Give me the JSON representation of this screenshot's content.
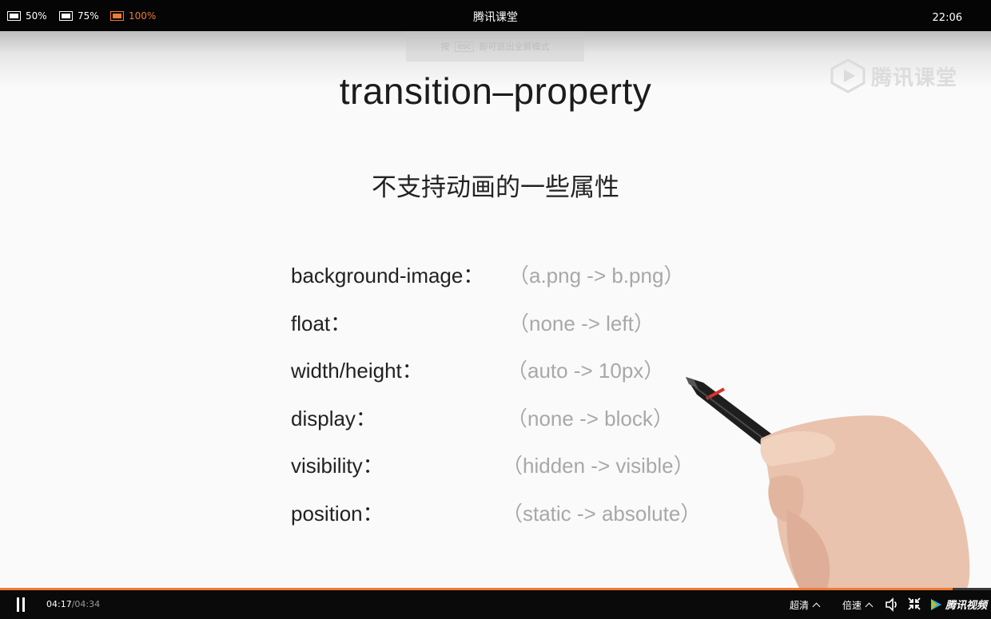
{
  "topbar": {
    "zoom_options": [
      {
        "label": "50%",
        "active": false
      },
      {
        "label": "75%",
        "active": false
      },
      {
        "label": "100%",
        "active": true
      }
    ],
    "title": "腾讯课堂",
    "clock": "22:06"
  },
  "video": {
    "esc_hint": {
      "prefix": "按",
      "key": "esc",
      "suffix": "即可退出全屏模式"
    },
    "watermark": "腾讯课堂",
    "slide": {
      "title": "transition–property",
      "subtitle": "不支持动画的一些属性",
      "rows": [
        {
          "name": "background-image：",
          "value": "（a.png -> b.png）"
        },
        {
          "name": "float：",
          "value": "（none -> left）"
        },
        {
          "name": "width/height：",
          "value": "（auto -> 10px）"
        },
        {
          "name": "display：",
          "value": "（none -> block）"
        },
        {
          "name": "visibility：",
          "value": "（hidden ->  visible）"
        },
        {
          "name": "position：",
          "value": "（static -> absolute）"
        }
      ]
    }
  },
  "player": {
    "progress": 0.961,
    "current_time": "04:17",
    "separator": "/",
    "duration": "04:34",
    "quality_label": "超清",
    "speed_label": "倍速",
    "brand": "腾讯视频"
  },
  "colors": {
    "accent": "#f07a34",
    "bar_bg": "#050505",
    "slide_bg": "#fafafa"
  },
  "icons": [
    "screen-50-icon",
    "screen-75-icon",
    "screen-100-icon",
    "pause-icon",
    "volume-icon",
    "exit-fullscreen-icon",
    "tencent-video-logo-icon",
    "tencent-classroom-logo-icon"
  ]
}
